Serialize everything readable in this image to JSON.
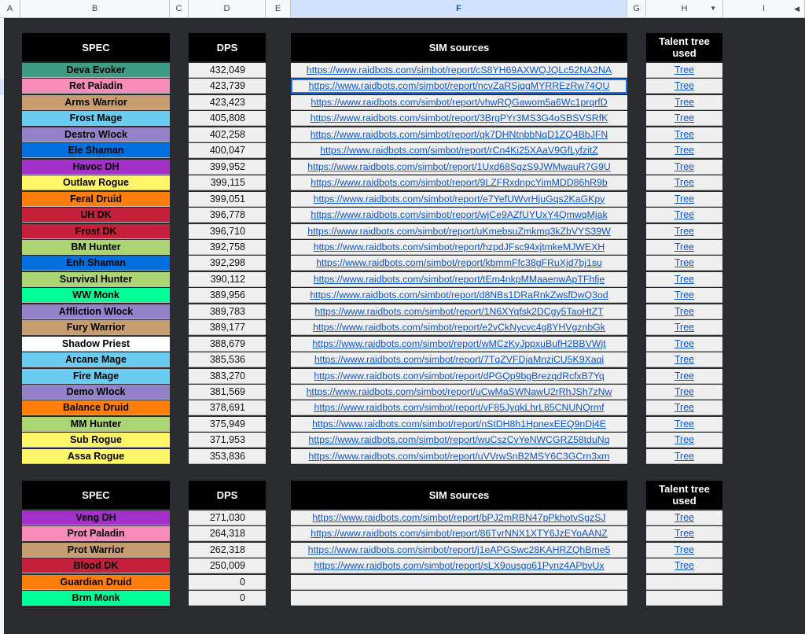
{
  "columns": [
    "A",
    "B",
    "C",
    "D",
    "E",
    "F",
    "G",
    "H",
    "I"
  ],
  "headers": {
    "spec": "SPEC",
    "dps": "DPS",
    "sources": "SIM sources",
    "tree": "Talent tree used"
  },
  "table1": [
    {
      "spec": "Deva Evoker",
      "color": "#3d9d84",
      "dps": "432,049",
      "url": "https://www.raidbots.com/simbot/report/cS8YH69AXWQJQLc52NA2NA",
      "tree": "Tree"
    },
    {
      "spec": "Ret Paladin",
      "color": "#f58cba",
      "dps": "423,739",
      "url": "https://www.raidbots.com/simbot/report/ncvZaRSjqgMYRREzRw74QU",
      "tree": "Tree"
    },
    {
      "spec": "Arms Warrior",
      "color": "#c79c6e",
      "dps": "423,423",
      "url": "https://www.raidbots.com/simbot/report/vhwRQGawom5a6Wc1prqrfD",
      "tree": "Tree"
    },
    {
      "spec": "Frost Mage",
      "color": "#69ccf0",
      "dps": "405,808",
      "url": "https://www.raidbots.com/simbot/report/3BrgPYr3MS3G4oSBSVSRfK",
      "tree": "Tree"
    },
    {
      "spec": "Destro Wlock",
      "color": "#9482c9",
      "dps": "402,258",
      "url": "https://www.raidbots.com/simbot/report/qk7DHNtnbbNqD1ZQ4BbJFN",
      "tree": "Tree"
    },
    {
      "spec": "Ele Shaman",
      "color": "#0070de",
      "dps": "400,047",
      "url": "https://www.raidbots.com/simbot/report/rCn4Ki25XAaV9GfLyfzitZ",
      "tree": "Tree"
    },
    {
      "spec": "Havoc DH",
      "color": "#a330c9",
      "dps": "399,952",
      "url": "https://www.raidbots.com/simbot/report/1Uxd68SgzS9JWMwauR7G9U",
      "tree": "Tree"
    },
    {
      "spec": "Outlaw Rogue",
      "color": "#fff569",
      "dps": "399,115",
      "url": "https://www.raidbots.com/simbot/report/9LZFRxdnpcYimMDD86hR9b",
      "tree": "Tree"
    },
    {
      "spec": "Feral Druid",
      "color": "#ff7d0a",
      "dps": "399,051",
      "url": "https://www.raidbots.com/simbot/report/e7YefUWvrHjuGqs2KaGKpy",
      "tree": "Tree"
    },
    {
      "spec": "UH DK",
      "color": "#c41f3b",
      "dps": "396,778",
      "url": "https://www.raidbots.com/simbot/report/wjCe9AZfUYUxY4QmwqMjak",
      "tree": "Tree"
    },
    {
      "spec": "Frost DK",
      "color": "#c41f3b",
      "dps": "396,710",
      "url": "https://www.raidbots.com/simbot/report/uKmebsuZmkmq3kZbVYS39W",
      "tree": "Tree"
    },
    {
      "spec": "BM Hunter",
      "color": "#abd473",
      "dps": "392,758",
      "url": "https://www.raidbots.com/simbot/report/hzpdJFsc94xjtmkeMJWEXH",
      "tree": "Tree"
    },
    {
      "spec": "Enh Shaman",
      "color": "#0070de",
      "dps": "392,298",
      "url": "https://www.raidbots.com/simbot/report/kbmmFfc38gFRuXjd7bj1su",
      "tree": "Tree"
    },
    {
      "spec": "Survival Hunter",
      "color": "#abd473",
      "dps": "390,112",
      "url": "https://www.raidbots.com/simbot/report/tEm4nkpMMaaenwApTFhfje",
      "tree": "Tree"
    },
    {
      "spec": "WW Monk",
      "color": "#00ff96",
      "dps": "389,956",
      "url": "https://www.raidbots.com/simbot/report/d8NBs1DRaRnkZwsfDwQ3od",
      "tree": "Tree"
    },
    {
      "spec": "Affliction Wlock",
      "color": "#9482c9",
      "dps": "389,783",
      "url": "https://www.raidbots.com/simbot/report/1N6XYqfsk2DCgy5TaoHtZT",
      "tree": "Tree"
    },
    {
      "spec": "Fury Warrior",
      "color": "#c79c6e",
      "dps": "389,177",
      "url": "https://www.raidbots.com/simbot/report/e2vCkNycvc4g8YHVgznbGk",
      "tree": "Tree"
    },
    {
      "spec": "Shadow Priest",
      "color": "#ffffff",
      "dps": "388,679",
      "url": "https://www.raidbots.com/simbot/report/wMCzKyJppxuBufH2BBVWjt",
      "tree": "Tree"
    },
    {
      "spec": "Arcane Mage",
      "color": "#69ccf0",
      "dps": "385,536",
      "url": "https://www.raidbots.com/simbot/report/7TqZVFDjaMnziCU5K9Xaqi",
      "tree": "Tree"
    },
    {
      "spec": "Fire Mage",
      "color": "#69ccf0",
      "dps": "383,270",
      "url": "https://www.raidbots.com/simbot/report/dPGQp9bgBrezqdRcfxB7Yq",
      "tree": "Tree"
    },
    {
      "spec": "Demo Wlock",
      "color": "#9482c9",
      "dps": "381,569",
      "url": "https://www.raidbots.com/simbot/report/uCwMaSWNawU2rRhJSh7zNw",
      "tree": "Tree"
    },
    {
      "spec": "Balance Druid",
      "color": "#ff7d0a",
      "dps": "378,691",
      "url": "https://www.raidbots.com/simbot/report/vF85JyqkLhrL85CNUNQrmf",
      "tree": "Tree"
    },
    {
      "spec": "MM Hunter",
      "color": "#abd473",
      "dps": "375,949",
      "url": "https://www.raidbots.com/simbot/report/nStDH8h1HpnexEEQ9nDj4E",
      "tree": "Tree"
    },
    {
      "spec": "Sub Rogue",
      "color": "#fff569",
      "dps": "371,953",
      "url": "https://www.raidbots.com/simbot/report/wuCszCvYeNWCGRZ58tduNq",
      "tree": "Tree"
    },
    {
      "spec": "Assa Rogue",
      "color": "#fff569",
      "dps": "353,836",
      "url": "https://www.raidbots.com/simbot/report/uVVrwSnB2MSY6C3GCrn3xm",
      "tree": "Tree"
    }
  ],
  "table2": [
    {
      "spec": "Veng DH",
      "color": "#a330c9",
      "dps": "271,030",
      "url": "https://www.raidbots.com/simbot/report/bPJ2mRBN47pPkhotvSgzSJ",
      "tree": "Tree"
    },
    {
      "spec": "Prot Paladin",
      "color": "#f58cba",
      "dps": "264,318",
      "url": "https://www.raidbots.com/simbot/report/86TvrNNX1XTY6JzEYoAANZ",
      "tree": "Tree"
    },
    {
      "spec": "Prot Warrior",
      "color": "#c79c6e",
      "dps": "262,318",
      "url": "https://www.raidbots.com/simbot/report/j1eAPGSwc28KAHRZQhBme5",
      "tree": "Tree"
    },
    {
      "spec": "Blood DK",
      "color": "#c41f3b",
      "dps": "250,009",
      "url": "https://www.raidbots.com/simbot/report/sLX9ousgg61Pynz4APbvUx",
      "tree": "Tree"
    },
    {
      "spec": "Guardian Druid",
      "color": "#ff7d0a",
      "dps": "0",
      "url": "",
      "tree": ""
    },
    {
      "spec": "Brm Monk",
      "color": "#00ff96",
      "dps": "0",
      "url": "",
      "tree": ""
    }
  ]
}
